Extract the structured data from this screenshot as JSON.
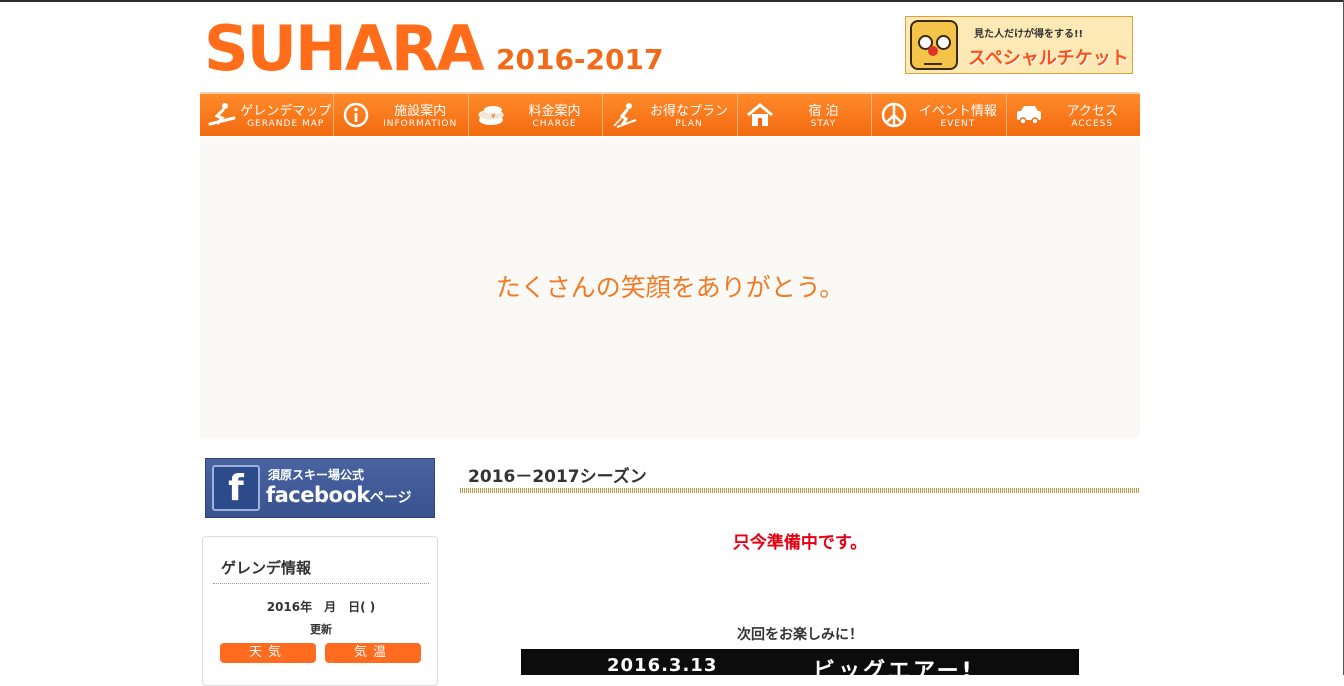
{
  "header": {
    "logo": "SUHARA",
    "season": "2016-2017",
    "ticket": {
      "small_text": "見た人だけが得をする!!",
      "big_text": "スペシャルチケット"
    }
  },
  "nav": {
    "items": [
      {
        "jp": "ゲレンデマップ",
        "en": "GERANDE MAP",
        "icon": "snowboarder-icon"
      },
      {
        "jp": "施設案内",
        "en": "INFORMATION",
        "icon": "info-icon"
      },
      {
        "jp": "料金案内",
        "en": "CHARGE",
        "icon": "coins-icon"
      },
      {
        "jp": "お得なプラン",
        "en": "PLAN",
        "icon": "skier-icon"
      },
      {
        "jp": "宿 泊",
        "en": "STAY",
        "icon": "house-icon"
      },
      {
        "jp": "イベント情報",
        "en": "EVENT",
        "icon": "peace-icon"
      },
      {
        "jp": "アクセス",
        "en": "ACCESS",
        "icon": "car-icon"
      }
    ]
  },
  "hero": {
    "text": "たくさんの笑顔をありがとう。"
  },
  "sidebar": {
    "facebook": {
      "line1": "須原スキー場公式",
      "line2": "facebook",
      "line2_suffix": "ページ"
    },
    "gelande": {
      "title": "ゲレンデ情報",
      "date": "2016年　月　日(  )",
      "updated": "更新",
      "weather_btn": "天気",
      "temp_btn": "気温"
    }
  },
  "main": {
    "title": "2016－2017シーズン",
    "notice": "只今準備中です。",
    "next": "次回をお楽しみに！",
    "banner_date": "2016.3.13",
    "banner_title": "ビッグエアー!"
  },
  "colors": {
    "brand_orange": "#ff6d1a",
    "notice_red": "#e60012",
    "facebook_blue": "#3b5998"
  }
}
